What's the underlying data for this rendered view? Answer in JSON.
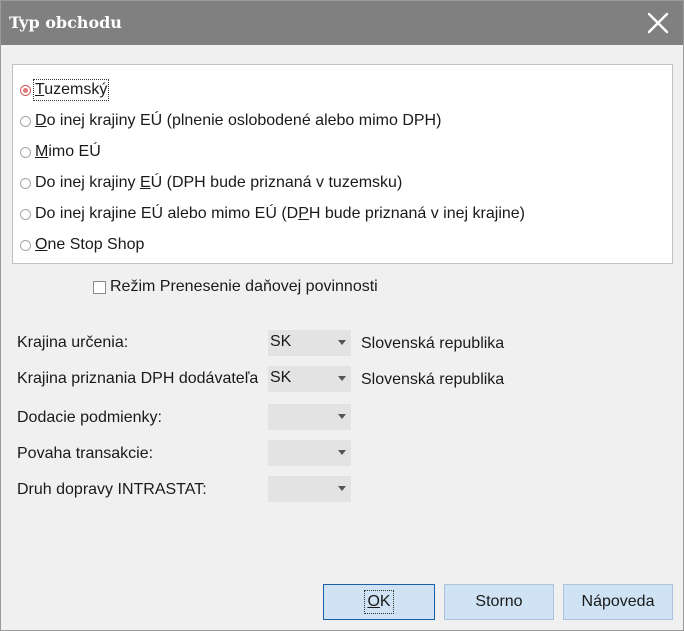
{
  "dialog": {
    "title": "Typ obchodu"
  },
  "trade_type": {
    "options": [
      {
        "pre": "",
        "key": "T",
        "post": "uzemský",
        "selected": true
      },
      {
        "pre": "",
        "key": "D",
        "post": "o inej krajiny EÚ (plnenie oslobodené alebo mimo DPH)",
        "selected": false
      },
      {
        "pre": "",
        "key": "M",
        "post": "imo EÚ",
        "selected": false
      },
      {
        "pre": "Do inej krajiny ",
        "key": "E",
        "post": "Ú (DPH bude priznaná v tuzemsku)",
        "selected": false
      },
      {
        "pre": "Do inej krajine EÚ alebo mimo EÚ (D",
        "key": "P",
        "post": "H bude priznaná v inej krajine)",
        "selected": false
      },
      {
        "pre": "",
        "key": "O",
        "post": "ne Stop Shop",
        "selected": false
      }
    ]
  },
  "reverse_charge": {
    "label": "Režim Prenesenie daňovej povinnosti",
    "checked": false
  },
  "fields": {
    "destination_country": {
      "label": "Krajina určenia:",
      "value": "SK",
      "country_name": "Slovenská republika"
    },
    "supplier_vat_country": {
      "label": "Krajina priznania DPH dodávateľa",
      "value": "SK",
      "country_name": "Slovenská republika"
    },
    "delivery_terms": {
      "label": "Dodacie podmienky:",
      "value": ""
    },
    "transaction_nature": {
      "label": "Povaha transakcie:",
      "value": ""
    },
    "intrastat_transport": {
      "label": "Druh dopravy INTRASTAT:",
      "value": ""
    }
  },
  "buttons": {
    "ok": {
      "key": "O",
      "rest": "K"
    },
    "cancel": "Storno",
    "help": "Nápoveda"
  },
  "colors": {
    "titlebar": "#808080",
    "button_fill": "#cfe3f5",
    "radio_selected": "#e07a7a"
  }
}
